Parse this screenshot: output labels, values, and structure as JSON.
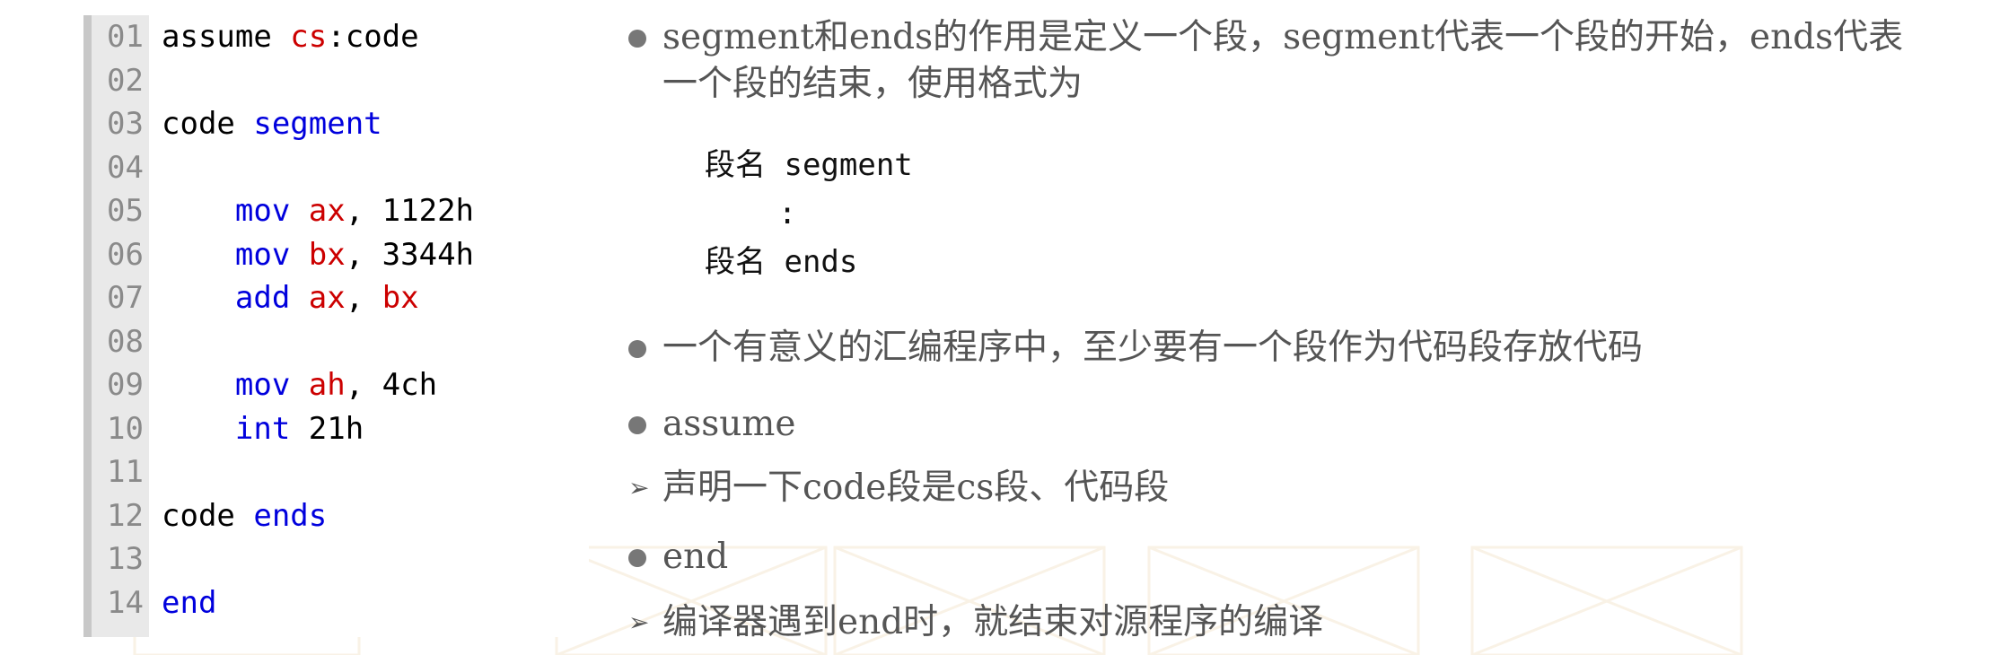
{
  "code": {
    "lines": [
      {
        "no": "01",
        "indent": 0,
        "tokens": [
          {
            "t": "assume ",
            "c": "plain"
          },
          {
            "t": "cs",
            "c": "reg"
          },
          {
            "t": ":code",
            "c": "plain"
          }
        ]
      },
      {
        "no": "02",
        "indent": 0,
        "tokens": []
      },
      {
        "no": "03",
        "indent": 0,
        "tokens": [
          {
            "t": "code ",
            "c": "plain"
          },
          {
            "t": "segment",
            "c": "kw"
          }
        ]
      },
      {
        "no": "04",
        "indent": 0,
        "tokens": []
      },
      {
        "no": "05",
        "indent": 4,
        "tokens": [
          {
            "t": "mov ",
            "c": "kw"
          },
          {
            "t": "ax",
            "c": "reg"
          },
          {
            "t": ", 1122h",
            "c": "plain"
          }
        ]
      },
      {
        "no": "06",
        "indent": 4,
        "tokens": [
          {
            "t": "mov ",
            "c": "kw"
          },
          {
            "t": "bx",
            "c": "reg"
          },
          {
            "t": ", 3344h",
            "c": "plain"
          }
        ]
      },
      {
        "no": "07",
        "indent": 4,
        "tokens": [
          {
            "t": "add ",
            "c": "kw"
          },
          {
            "t": "ax",
            "c": "reg"
          },
          {
            "t": ", ",
            "c": "plain"
          },
          {
            "t": "bx",
            "c": "reg"
          }
        ]
      },
      {
        "no": "08",
        "indent": 0,
        "tokens": []
      },
      {
        "no": "09",
        "indent": 4,
        "tokens": [
          {
            "t": "mov ",
            "c": "kw"
          },
          {
            "t": "ah",
            "c": "reg"
          },
          {
            "t": ", 4ch",
            "c": "plain"
          }
        ]
      },
      {
        "no": "10",
        "indent": 4,
        "tokens": [
          {
            "t": "int ",
            "c": "kw"
          },
          {
            "t": "21h",
            "c": "plain"
          }
        ]
      },
      {
        "no": "11",
        "indent": 0,
        "tokens": []
      },
      {
        "no": "12",
        "indent": 0,
        "tokens": [
          {
            "t": "code ",
            "c": "plain"
          },
          {
            "t": "ends",
            "c": "kw"
          }
        ]
      },
      {
        "no": "13",
        "indent": 0,
        "tokens": []
      },
      {
        "no": "14",
        "indent": 0,
        "tokens": [
          {
            "t": "end",
            "c": "kw"
          }
        ]
      }
    ]
  },
  "notes": {
    "item1": "segment和ends的作用是定义一个段，segment代表一个段的开始，ends代表一个段的结束，使用格式为",
    "format": {
      "line1": "段名 segment",
      "line2": "    :",
      "line3": "段名 ends"
    },
    "item2": "一个有意义的汇编程序中，至少要有一个段作为代码段存放代码",
    "item3": "assume",
    "item3_sub": "声明一下code段是cs段、代码段",
    "item4": "end",
    "item4_sub": "编译器遇到end时，就结束对源程序的编译"
  },
  "colors": {
    "keyword": "#0000dd",
    "register": "#cc0000",
    "linenum": "#8a8a8a",
    "text": "#555555"
  }
}
